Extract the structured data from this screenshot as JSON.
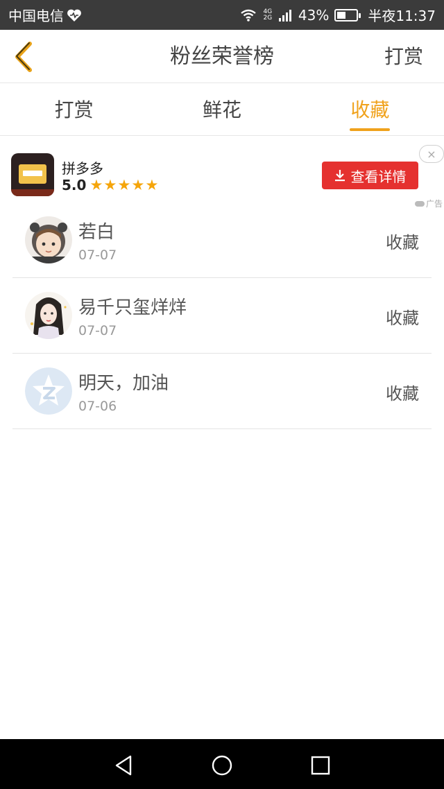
{
  "status_bar": {
    "carrier": "中国电信",
    "network": "4G 2G",
    "battery": "43%",
    "battery_level": 0.43,
    "time": "半夜11:37"
  },
  "header": {
    "title": "粉丝荣誉榜",
    "action": "打赏"
  },
  "tabs": [
    {
      "label": "打赏",
      "active": false
    },
    {
      "label": "鲜花",
      "active": false
    },
    {
      "label": "收藏",
      "active": true
    }
  ],
  "ad": {
    "app_name": "拼多多",
    "rating": "5.0",
    "stars": 5,
    "button_label": "查看详情",
    "close": "×",
    "tag": "广告",
    "accent_color": "#e5312f"
  },
  "list": [
    {
      "name": "若白",
      "date": "07-07",
      "type": "收藏",
      "avatar": "cartoon-boy-avatar"
    },
    {
      "name": "易千只玺烊烊",
      "date": "07-07",
      "type": "收藏",
      "avatar": "anime-girl-avatar"
    },
    {
      "name": "明天，加油",
      "date": "07-06",
      "type": "收藏",
      "avatar": "qzone-star-avatar"
    }
  ],
  "colors": {
    "accent": "#f0a21c",
    "status_bar": "#3b3b3b",
    "nav_bar": "#000000"
  }
}
